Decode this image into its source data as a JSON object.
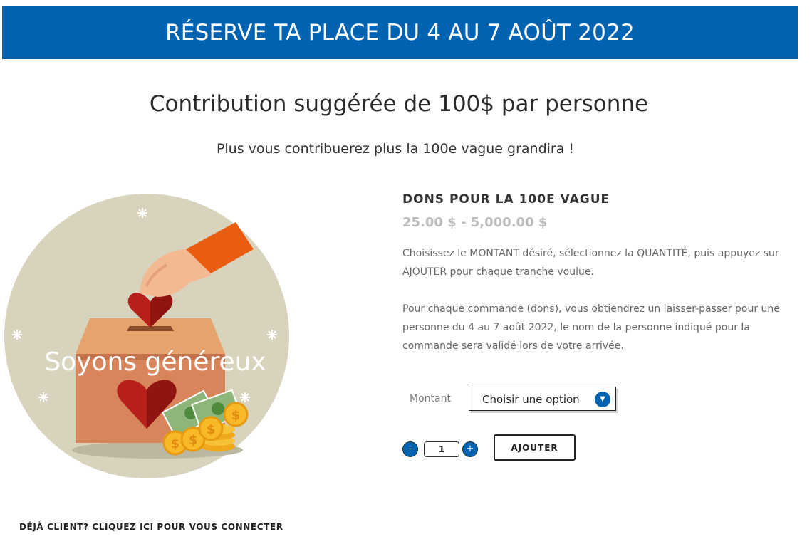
{
  "banner": {
    "text": "RÉSERVE TA PLACE DU 4 AU 7 AOÛT 2022"
  },
  "heading": "Contribution suggérée de 100$ par personne",
  "subheading": "Plus vous contribuerez plus la 100e vague grandira !",
  "illustration": {
    "caption": "Soyons généreux",
    "icons": [
      "hand-icon",
      "heart-icon",
      "ballot-box-icon",
      "money-icon",
      "coins-icon",
      "sparkle-icon"
    ]
  },
  "product": {
    "title": "DONS POUR LA 100E VAGUE",
    "price_min": "25.00 $",
    "price_sep": "-",
    "price_max": "5,000.00 $",
    "desc1": "Choisissez le MONTANT désiré, sélectionnez la QUANTITÉ, puis appuyez sur AJOUTER pour chaque tranche voulue.",
    "desc2": "Pour chaque commande (dons), vous obtiendrez un laisser-passer pour une personne du 4 au 7 août 2022, le nom de la personne indiqué pour la commande sera validé lors de votre arrivée."
  },
  "variation": {
    "label": "Montant",
    "selected": "Choisir une option"
  },
  "quantity": {
    "minus": "-",
    "value": "1",
    "plus": "+"
  },
  "add_button": "AJOUTER",
  "login_link": "DÉJÀ CLIENT? CLIQUEZ ICI POUR VOUS CONNECTER",
  "colors": {
    "brand_blue": "#0063b1",
    "circle_bg": "#d8d3bd",
    "heart_red": "#b8211b",
    "box_orange": "#d9855c"
  }
}
